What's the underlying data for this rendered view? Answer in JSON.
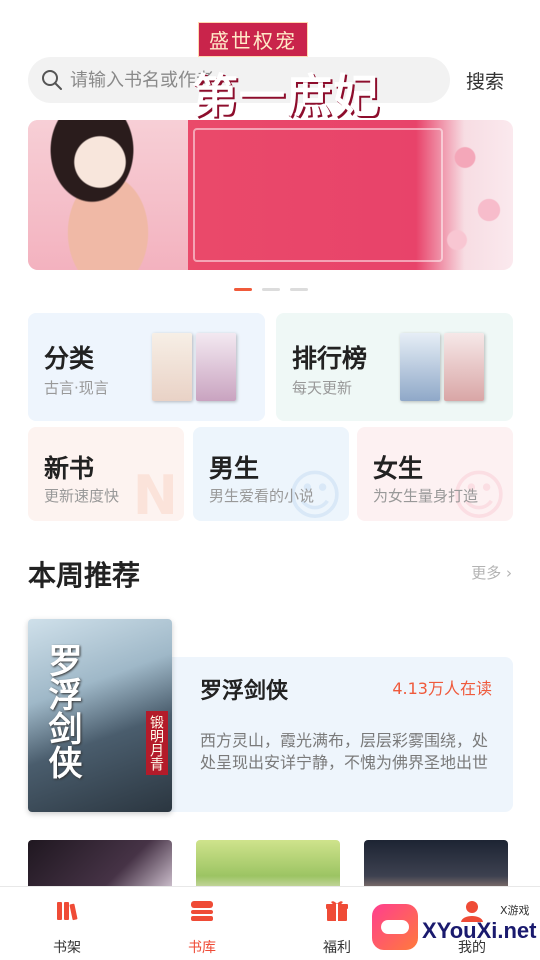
{
  "search": {
    "placeholder": "请输入书名或作者",
    "button_label": "搜索"
  },
  "banner": {
    "subtitle": "盛世权宠",
    "title": "第一庶妃",
    "slide_count": 3,
    "active_slide": 1
  },
  "categories": {
    "classify": {
      "title": "分类",
      "subtitle": "古言·现言"
    },
    "ranking": {
      "title": "排行榜",
      "subtitle": "每天更新"
    },
    "new_books": {
      "title": "新书",
      "subtitle": "更新速度快"
    },
    "male": {
      "title": "男生",
      "subtitle": "男生爱看的小说"
    },
    "female": {
      "title": "女生",
      "subtitle": "为女生量身打造"
    }
  },
  "weekly": {
    "title": "本周推荐",
    "more_label": "更多 ›",
    "featured": {
      "name": "罗浮剑侠",
      "readers": "4.13万人在读",
      "description": "西方灵山，霞光满布，层层彩雾围绕，处处呈现出安详宁静，不愧为佛界圣地出世",
      "cover_text": "罗浮剑侠",
      "cover_author": "锻明月青"
    }
  },
  "tabs": [
    {
      "label": "书架",
      "active": false,
      "icon": "bookshelf-icon"
    },
    {
      "label": "书库",
      "active": true,
      "icon": "library-icon"
    },
    {
      "label": "福利",
      "active": false,
      "icon": "gift-icon"
    },
    {
      "label": "我的",
      "active": false,
      "icon": "profile-icon"
    }
  ],
  "watermark": {
    "brand": "XYouXi.net",
    "sub": "X游戏"
  },
  "colors": {
    "accent": "#ef4b36",
    "banner_red": "#e8436a"
  }
}
